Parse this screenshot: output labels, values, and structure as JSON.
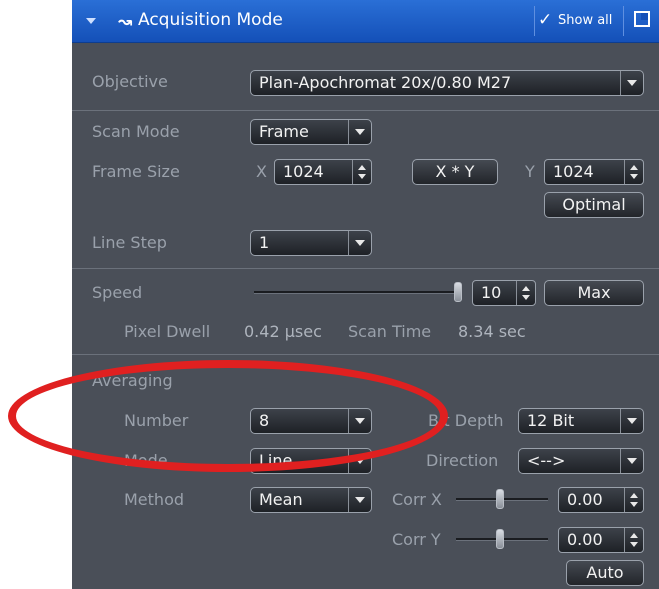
{
  "header": {
    "title": "Acquisition Mode",
    "show_all": "Show all"
  },
  "objective": {
    "label": "Objective",
    "value": "Plan-Apochromat 20x/0.80   M27"
  },
  "scan_mode": {
    "label": "Scan Mode",
    "value": "Frame"
  },
  "frame_size": {
    "label": "Frame Size",
    "x_label": "X",
    "x_value": "1024",
    "xy_button": "X * Y",
    "y_label": "Y",
    "y_value": "1024",
    "optimal_button": "Optimal"
  },
  "line_step": {
    "label": "Line Step",
    "value": "1"
  },
  "speed": {
    "label": "Speed",
    "value": "10",
    "max_button": "Max"
  },
  "timing": {
    "pixel_dwell_label": "Pixel Dwell",
    "pixel_dwell_value": "0.42 µsec",
    "scan_time_label": "Scan Time",
    "scan_time_value": "8.34 sec"
  },
  "averaging": {
    "section_label": "Averaging",
    "number_label": "Number",
    "number_value": "8",
    "bit_depth_label": "Bit Depth",
    "bit_depth_value": "12 Bit",
    "mode_label": "Mode",
    "mode_value": "Line",
    "direction_label": "Direction",
    "direction_value": "<-->",
    "method_label": "Method",
    "method_value": "Mean",
    "corr_x_label": "Corr X",
    "corr_x_value": "0.00",
    "corr_y_label": "Corr Y",
    "corr_y_value": "0.00",
    "auto_button": "Auto"
  },
  "colors": {
    "header_blue": "#1450b8",
    "panel_bg": "#4a4f58",
    "highlight_red": "#e02020"
  }
}
